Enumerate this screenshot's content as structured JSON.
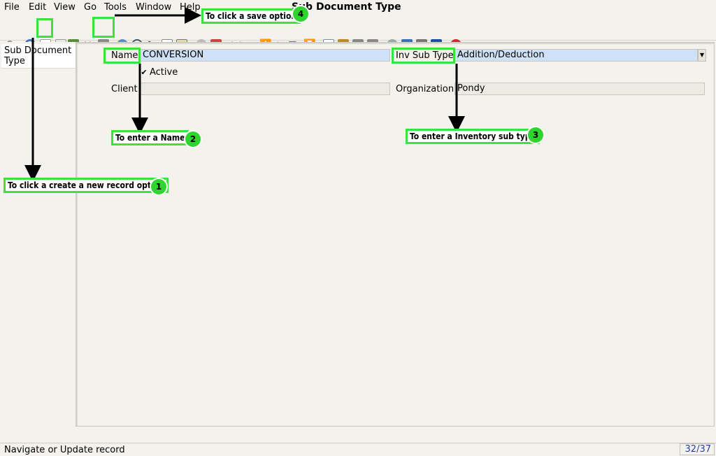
{
  "menu": {
    "file": "File",
    "edit": "Edit",
    "view": "View",
    "go": "Go",
    "tools": "Tools",
    "window": "Window",
    "help": "Help"
  },
  "window_title": "Sub Document Type",
  "tree": {
    "item": "Sub Document Type"
  },
  "form": {
    "name_label": "Name",
    "name_value": "CONVERSION",
    "inv_sub_type_label": "Inv Sub Type",
    "inv_sub_type_value": "Addition/Deduction",
    "active_label": "Active",
    "active_checked": true,
    "client_label": "Client",
    "client_value": "",
    "organization_label": "Organization",
    "organization_value": "Pondy"
  },
  "status": {
    "text": "Navigate or Update record",
    "record": "32/37"
  },
  "annotations": {
    "a1": {
      "text": "To click a create a new record option",
      "num": "1"
    },
    "a2": {
      "text": "To enter a Name",
      "num": "2"
    },
    "a3": {
      "text": "To enter a Inventory sub type",
      "num": "3"
    },
    "a4": {
      "text": "To click a save option",
      "num": "4"
    }
  },
  "colors": {
    "highlight": "#3ee23e",
    "field_blue": "#cfe1f6",
    "record_text": "#2742a8"
  },
  "toolbar_icons": [
    "undo-icon",
    "help-icon",
    "new-record-icon",
    "copy-record-icon",
    "archive-icon",
    "delete-icon",
    "save-icon",
    "refresh-icon",
    "find-icon",
    "attachment-icon",
    "chat-icon",
    "grid-toggle-icon",
    "history-icon",
    "home-icon",
    "back-icon",
    "forward-icon",
    "first-record-icon",
    "previous-record-icon",
    "next-record-icon",
    "last-record-icon",
    "report-icon",
    "archive-view-icon",
    "print-preview-icon",
    "print-icon",
    "zoom-across-icon",
    "workflow-icon",
    "product-info-icon",
    "active-workflows-icon",
    "close-window-icon"
  ]
}
